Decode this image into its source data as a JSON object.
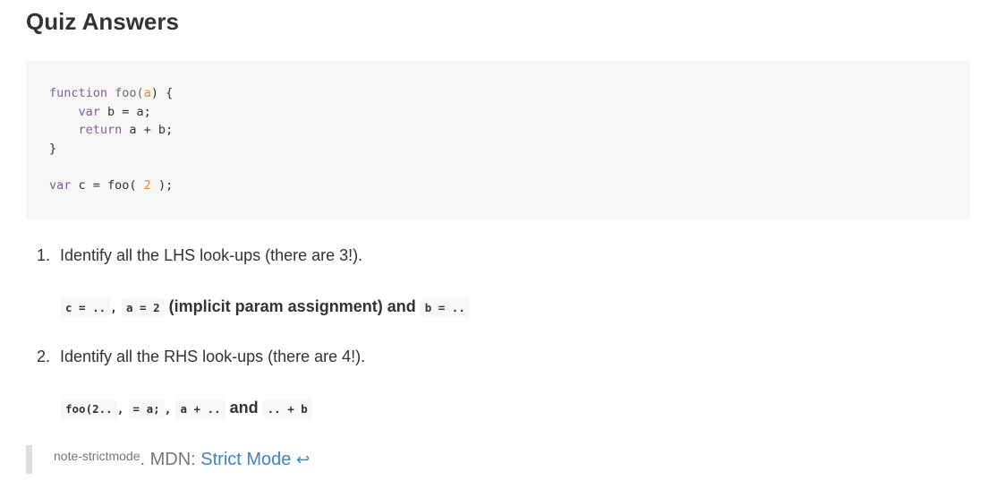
{
  "heading": "Quiz Answers",
  "code": {
    "line1": {
      "kw": "function",
      "name": "foo(",
      "param": "a",
      "rest": ") {"
    },
    "line2": {
      "kw": "var",
      "rest": " b = a;"
    },
    "line3": {
      "kw": "return",
      "rest": " a + b;"
    },
    "line4": {
      "rest": "}"
    },
    "line6": {
      "kw": "var",
      "rest1": " c = foo( ",
      "num": "2",
      "rest2": " );"
    }
  },
  "answers": [
    {
      "number": "1.",
      "question": "Identify all the LHS look-ups (there are 3!).",
      "code1": "c = ..",
      "sep1": ",",
      "code2": "a = 2",
      "text1": " (implicit param assignment) and ",
      "code3": "b = .."
    },
    {
      "number": "2.",
      "question": "Identify all the RHS look-ups (there are 4!).",
      "code1": "foo(2..",
      "sep1": ",",
      "code2": "= a;",
      "sep2": ",",
      "code3": "a + ..",
      "text1": " and ",
      "code4": ".. + b"
    }
  ],
  "footnote": {
    "label": "note-strictmode",
    "prefix": ". MDN: ",
    "link_text": "Strict Mode",
    "back_icon": "↩"
  }
}
